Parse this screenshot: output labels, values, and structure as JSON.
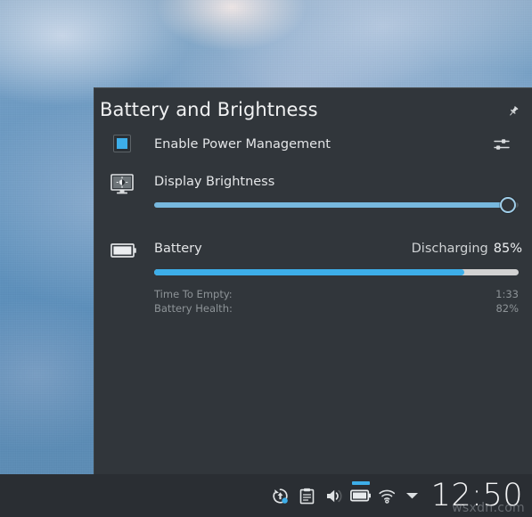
{
  "popup": {
    "title": "Battery and Brightness",
    "pin_icon": "pin-icon",
    "power_management": {
      "label": "Enable Power Management",
      "checked": true,
      "checkbox_icon": "checkbox-checked-icon",
      "configure_icon": "configure-sliders-icon"
    },
    "brightness": {
      "label": "Display Brightness",
      "icon": "monitor-brightness-icon",
      "value_percent": 98
    },
    "battery": {
      "label": "Battery",
      "icon": "battery-icon",
      "state": "Discharging",
      "percent_label": "85%",
      "value_percent": 85,
      "details": [
        {
          "key": "Time To Empty:",
          "value": "1:33"
        },
        {
          "key": "Battery Health:",
          "value": "82%"
        }
      ]
    }
  },
  "taskbar": {
    "tray": [
      {
        "name": "software-updates-icon",
        "label": "Software Updates"
      },
      {
        "name": "clipboard-icon",
        "label": "Clipboard"
      },
      {
        "name": "volume-icon",
        "label": "Volume"
      },
      {
        "name": "battery-tray-icon",
        "label": "Battery and Brightness",
        "active": true
      },
      {
        "name": "wifi-icon",
        "label": "Networks"
      }
    ],
    "expand_arrow_icon": "chevron-down-icon",
    "clock": "12:50"
  },
  "watermark": "wsxdn.com",
  "colors": {
    "accent": "#3daee9",
    "panel_bg": "#31363b",
    "taskbar_bg": "#2a2e33",
    "battery_bar_remaining": "#d2d2d2",
    "brightness_fill": "#77b8de",
    "text_primary": "#e3e5e7",
    "text_muted": "#8d9397"
  }
}
